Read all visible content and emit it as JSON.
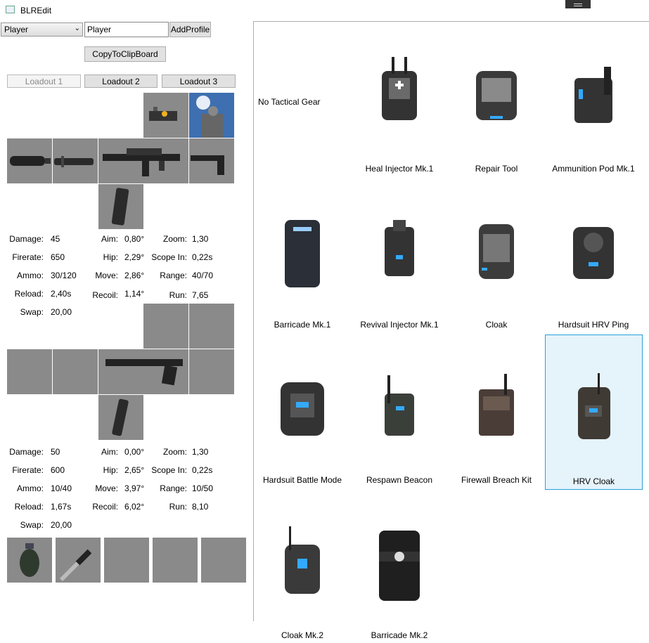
{
  "window": {
    "title": "BLREdit"
  },
  "profile": {
    "selected": "Player",
    "name_value": "Player",
    "add_label": "AddProfile"
  },
  "clipboard_label": "CopyToClipBoard",
  "loadouts": [
    "Loadout 1",
    "Loadout 2",
    "Loadout 3"
  ],
  "primary": {
    "stats": [
      [
        "Damage:",
        "45",
        "Aim:",
        "0,80°",
        "Zoom:",
        "1,30"
      ],
      [
        "Firerate:",
        "650",
        "Hip:",
        "2,29°",
        "Scope In:",
        "0,22s"
      ],
      [
        "Ammo:",
        "30/120",
        "Move:",
        "2,86°",
        "Range:",
        "40/70"
      ],
      [
        "Reload:",
        "2,40s",
        "Recoil:",
        "1,14°",
        "Run:",
        "7,65"
      ],
      [
        "Swap:",
        "20,00",
        "",
        "",
        "",
        ""
      ]
    ]
  },
  "secondary": {
    "stats": [
      [
        "Damage:",
        "50",
        "Aim:",
        "0,00°",
        "Zoom:",
        "1,30"
      ],
      [
        "Firerate:",
        "600",
        "Hip:",
        "2,65°",
        "Scope In:",
        "0,22s"
      ],
      [
        "Ammo:",
        "10/40",
        "Move:",
        "3,97°",
        "Range:",
        "10/50"
      ],
      [
        "Reload:",
        "1,67s",
        "Recoil:",
        "6,02°",
        "Run:",
        "8,10"
      ],
      [
        "Swap:",
        "20,00",
        "",
        "",
        "",
        ""
      ]
    ]
  },
  "gear": {
    "none_label": "No Tactical Gear",
    "items": [
      "Heal Injector Mk.1",
      "Repair Tool",
      "Ammunition Pod Mk.1",
      "Barricade Mk.1",
      "Revival Injector Mk.1",
      "Cloak",
      "Hardsuit HRV Ping",
      "Hardsuit Battle Mode",
      "Respawn Beacon",
      "Firewall Breach Kit",
      "HRV Cloak",
      "Cloak Mk.2",
      "Barricade Mk.2"
    ],
    "selected": "HRV Cloak"
  },
  "colors": {
    "tile": "#8a8a8a",
    "selection_bg": "#e5f3fb",
    "selection_border": "#26a0da"
  }
}
